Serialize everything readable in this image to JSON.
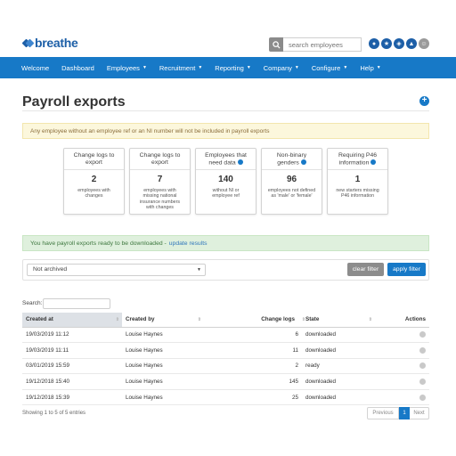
{
  "app": {
    "logo_text": "breathe"
  },
  "header": {
    "search_placeholder": "search employees",
    "icons": [
      "chat-icon",
      "star-icon",
      "lightbulb-icon",
      "bell-icon",
      "user-avatar-icon"
    ]
  },
  "nav": {
    "items": [
      {
        "label": "Welcome",
        "dropdown": false
      },
      {
        "label": "Dashboard",
        "dropdown": false
      },
      {
        "label": "Employees",
        "dropdown": true
      },
      {
        "label": "Recruitment",
        "dropdown": true
      },
      {
        "label": "Reporting",
        "dropdown": true
      },
      {
        "label": "Company",
        "dropdown": true
      },
      {
        "label": "Configure",
        "dropdown": true
      },
      {
        "label": "Help",
        "dropdown": true
      }
    ]
  },
  "page": {
    "title": "Payroll exports",
    "warning": "Any employee without an employee ref or an NI number will not be included in payroll exports"
  },
  "cards": [
    {
      "title_1": "Change logs to",
      "title_2": "export",
      "value": "2",
      "desc_1": "employees with",
      "desc_2": "changes",
      "desc_3": "",
      "desc_4": ""
    },
    {
      "title_1": "Change logs to",
      "title_2": "export",
      "value": "7",
      "desc_1": "employees with",
      "desc_2": "missing national",
      "desc_3": "insurance numbers",
      "desc_4": "with changes"
    },
    {
      "title_1": "Employees that",
      "title_2": "need data",
      "value": "140",
      "desc_1": "without NI or",
      "desc_2": "employee ref",
      "desc_3": "",
      "desc_4": ""
    },
    {
      "title_1": "Non-binary",
      "title_2": "genders",
      "value": "96",
      "desc_1": "employees not defined",
      "desc_2": "as 'male' or 'female'",
      "desc_3": "",
      "desc_4": ""
    },
    {
      "title_1": "Requiring P46",
      "title_2": "information",
      "value": "1",
      "desc_1": "new starters missing",
      "desc_2": "P46 information",
      "desc_3": "",
      "desc_4": ""
    }
  ],
  "success": {
    "text": "You have payroll exports ready to be downloaded -",
    "link": "update results"
  },
  "filter": {
    "selected": "Not archived",
    "clear_label": "clear filter",
    "apply_label": "apply filter"
  },
  "table": {
    "search_label": "Search:",
    "columns": [
      "Created at",
      "Created by",
      "Change logs",
      "State",
      "Actions"
    ],
    "rows": [
      {
        "created_at": "19/03/2019 11:12",
        "created_by": "Louise Haynes",
        "change_logs": "6",
        "state": "downloaded"
      },
      {
        "created_at": "19/03/2019 11:11",
        "created_by": "Louise Haynes",
        "change_logs": "11",
        "state": "downloaded"
      },
      {
        "created_at": "03/01/2019 15:59",
        "created_by": "Louise Haynes",
        "change_logs": "2",
        "state": "ready"
      },
      {
        "created_at": "19/12/2018 15:40",
        "created_by": "Louise Haynes",
        "change_logs": "145",
        "state": "downloaded"
      },
      {
        "created_at": "19/12/2018 15:39",
        "created_by": "Louise Haynes",
        "change_logs": "25",
        "state": "downloaded"
      }
    ],
    "info": "Showing 1 to 5 of 5 entries",
    "pagination": {
      "prev": "Previous",
      "current": "1",
      "next": "Next"
    }
  }
}
